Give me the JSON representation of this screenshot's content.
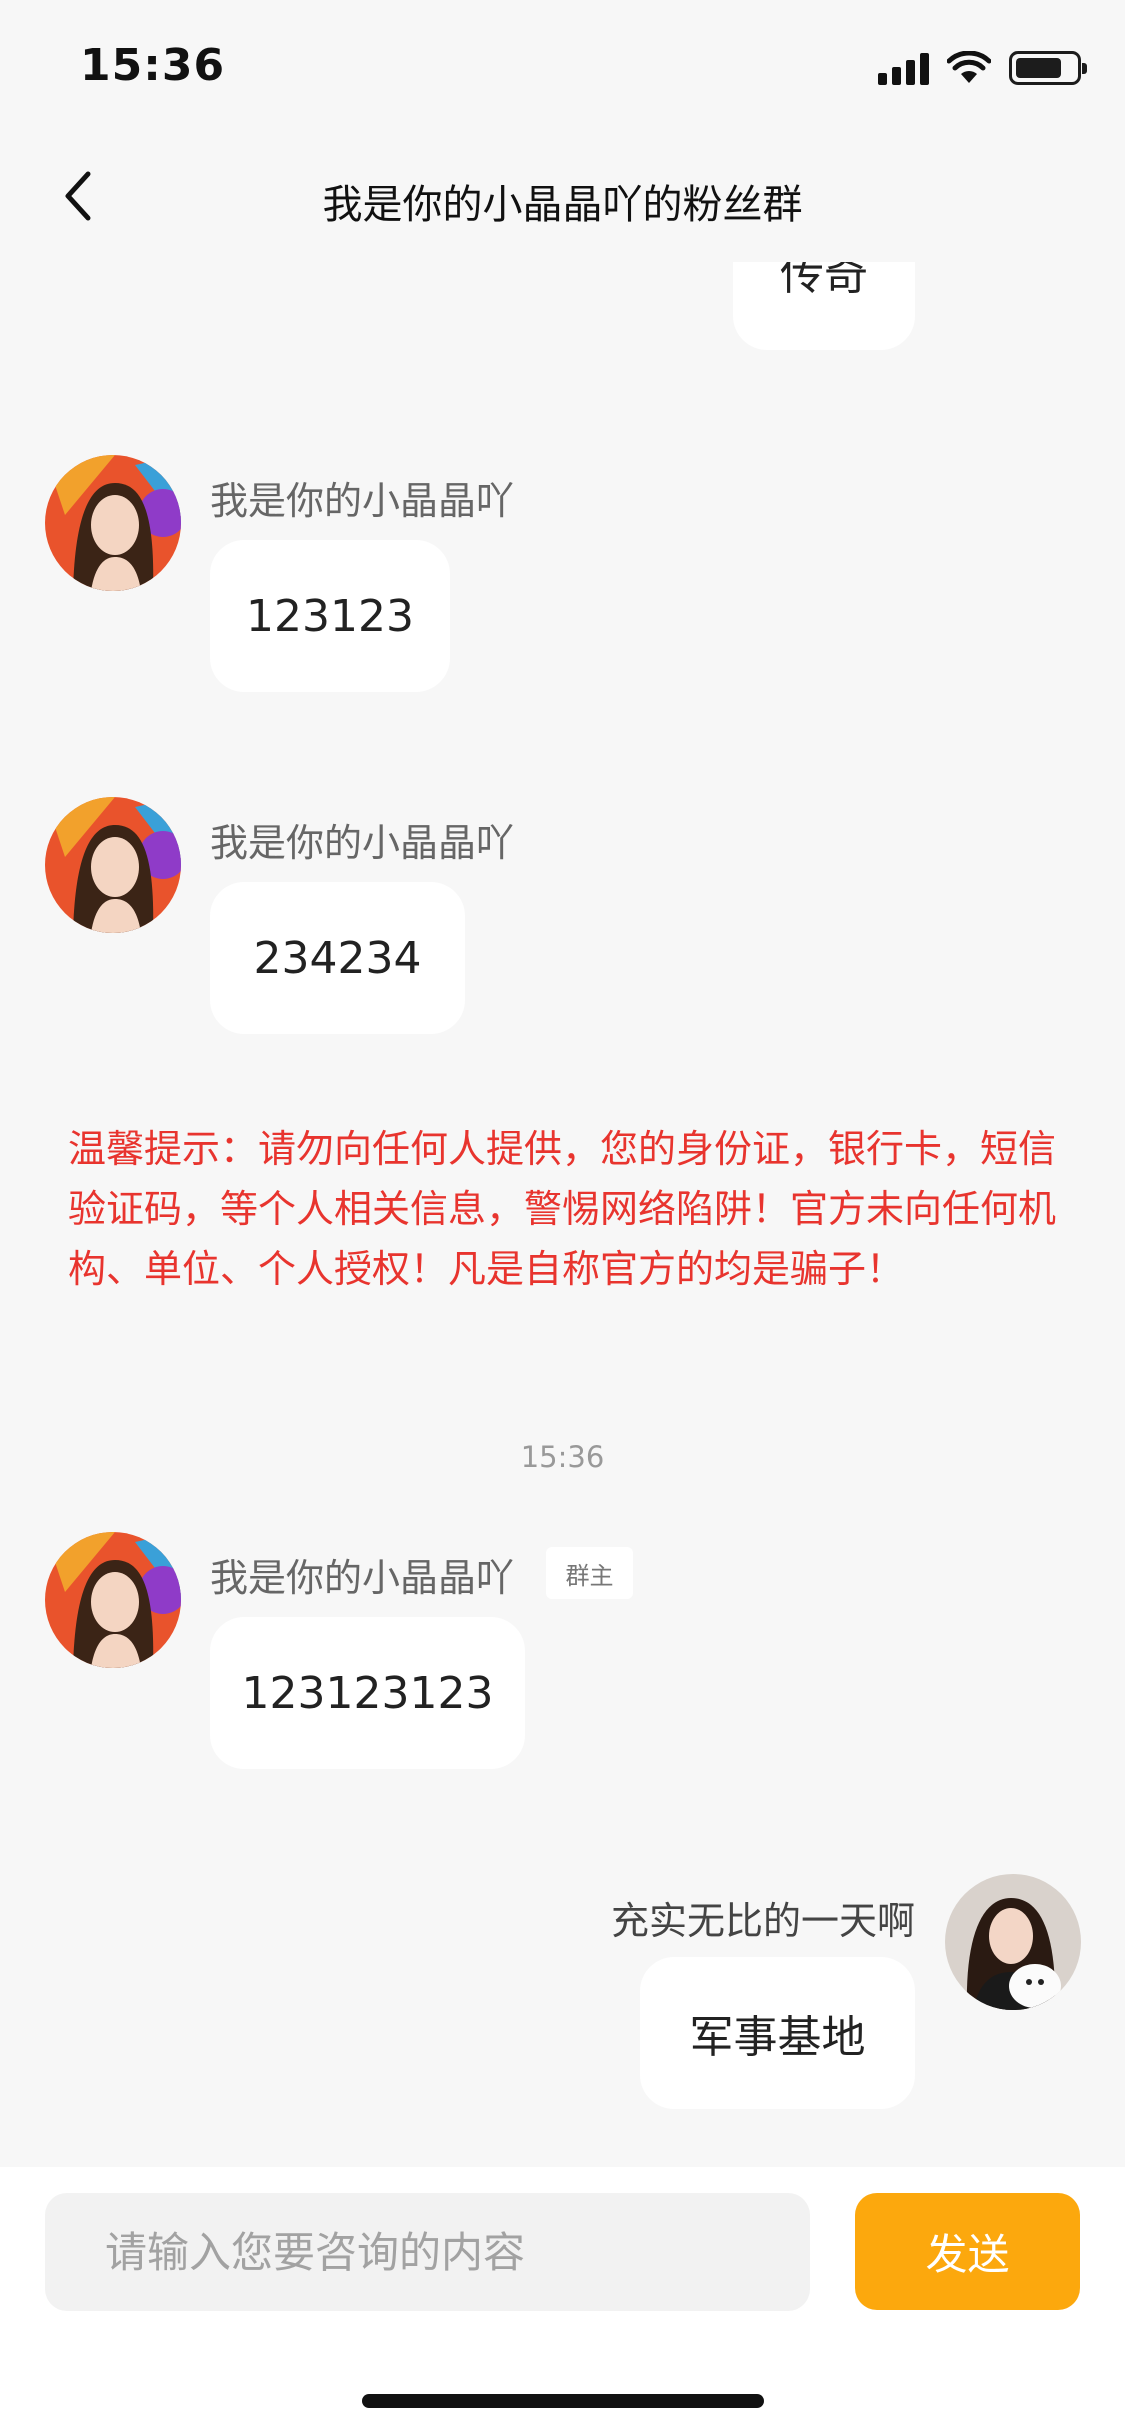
{
  "status_bar": {
    "time": "15:36"
  },
  "header": {
    "title": "我是你的小晶晶吖的粉丝群"
  },
  "messages": [
    {
      "text": "传奇"
    },
    {
      "sender": "我是你的小晶晶吖",
      "text": "123123"
    },
    {
      "sender": "我是你的小晶晶吖",
      "text": "234234"
    },
    {
      "sender": "我是你的小晶晶吖",
      "badge": "群主",
      "text": "123123123"
    },
    {
      "sender": "充实无比的一天啊",
      "text": "军事基地"
    }
  ],
  "notice": {
    "text": "温馨提示：请勿向任何人提供，您的身份证，银行卡，短信验证码，等个人相关信息，警惕网络陷阱！官方未向任何机构、单位、个人授权！凡是自称官方的均是骗子！"
  },
  "time_divider": "15:36",
  "input_bar": {
    "placeholder": "请输入您要咨询的内容",
    "send_label": "发送"
  },
  "colors": {
    "accent": "#fca80d",
    "warning": "#e8342e",
    "background": "#f7f7f7"
  },
  "icons": {
    "back": "chevron-left-icon",
    "signal": "cellular-signal-icon",
    "wifi": "wifi-icon",
    "battery": "battery-icon"
  },
  "battery_level": 0.78
}
